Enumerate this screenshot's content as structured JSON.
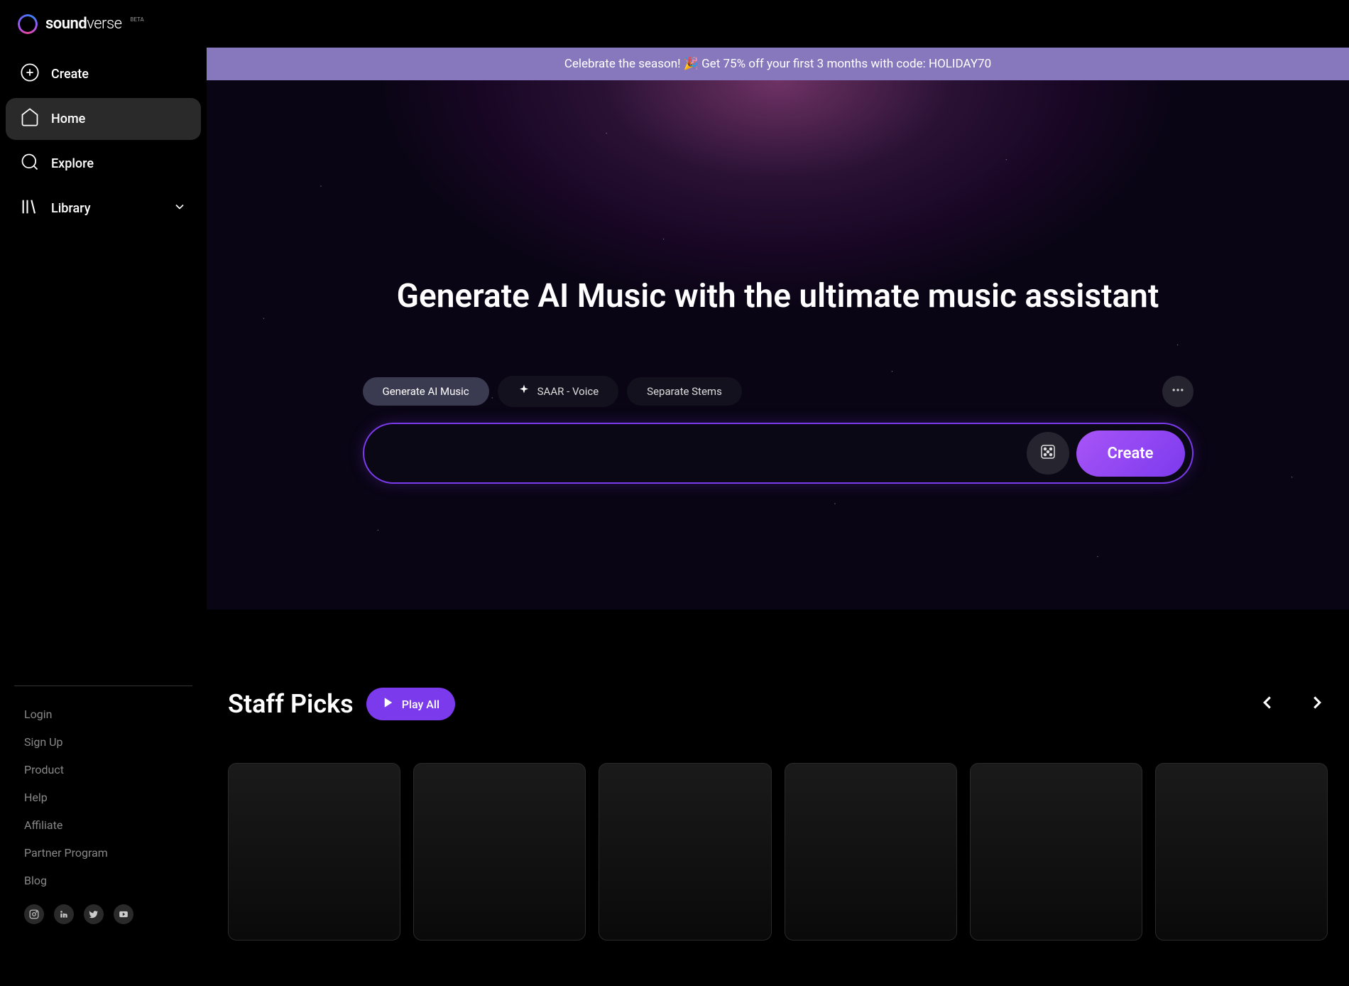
{
  "brand": {
    "name_part1": "sound",
    "name_part2": "verse",
    "beta_label": "BETA"
  },
  "sidebar": {
    "items": [
      {
        "label": "Create",
        "icon": "plus"
      },
      {
        "label": "Home",
        "icon": "home"
      },
      {
        "label": "Explore",
        "icon": "search"
      },
      {
        "label": "Library",
        "icon": "library",
        "expandable": true
      }
    ],
    "footer_links": [
      "Login",
      "Sign Up",
      "Product",
      "Help",
      "Affiliate",
      "Partner Program",
      "Blog"
    ],
    "socials": [
      "instagram",
      "linkedin",
      "twitter",
      "youtube"
    ]
  },
  "banner": {
    "text": "Celebrate the season! 🎉 Get 75% off your first 3 months with code: HOLIDAY70"
  },
  "hero": {
    "title": "Generate AI Music with the ultimate music assistant",
    "chips": [
      {
        "label": "Generate AI Music",
        "active": true
      },
      {
        "label": "SAAR - Voice",
        "icon": "sparkle"
      },
      {
        "label": "Separate Stems"
      }
    ],
    "create_button": "Create",
    "input_placeholder": ""
  },
  "section": {
    "title": "Staff Picks",
    "play_all": "Play All"
  }
}
